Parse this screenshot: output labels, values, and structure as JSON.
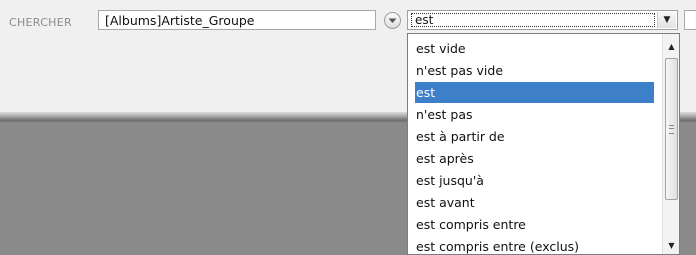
{
  "search": {
    "label": "CHERCHER",
    "field_value": "[Albums]Artiste_Groupe"
  },
  "operator": {
    "selected": "est",
    "options": [
      "est vide",
      "n'est pas vide",
      "est",
      "n'est pas",
      "est à partir de",
      "est après",
      "est jusqu'à",
      "est avant",
      "est compris entre",
      "est compris entre (exclus)"
    ],
    "selected_index": 2
  },
  "colors": {
    "selection": "#3d7fc9",
    "toolbar": "#f0f0f0",
    "background": "#8a8a8a"
  },
  "icons": {
    "field_menu": "circle-chevron-down-icon",
    "dropdown": "triangle-down-icon",
    "scroll_up": "triangle-up-icon",
    "scroll_down": "triangle-down-icon"
  }
}
